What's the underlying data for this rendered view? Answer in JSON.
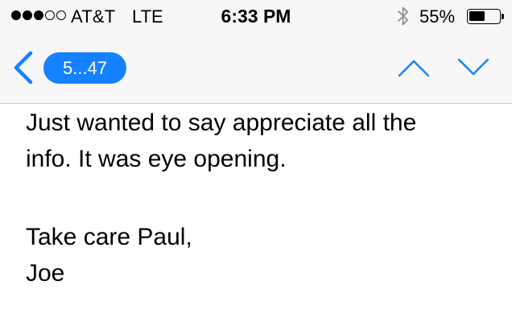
{
  "status_bar": {
    "signal_bars_filled": 3,
    "signal_bars_total": 5,
    "carrier": "AT&T",
    "network": "LTE",
    "time": "6:33 PM",
    "battery_percent_label": "55%",
    "battery_level": 0.55
  },
  "nav": {
    "back_icon": "chevron-left-icon",
    "counter_label": "5...47",
    "previous_icon": "chevron-up-icon",
    "next_icon": "chevron-down-icon",
    "accent_color": "#1581ff"
  },
  "message": {
    "line1": "Just wanted to say appreciate all the",
    "line2": "info. It was eye opening.",
    "closing": "Take care Paul,",
    "signature": "Joe"
  }
}
